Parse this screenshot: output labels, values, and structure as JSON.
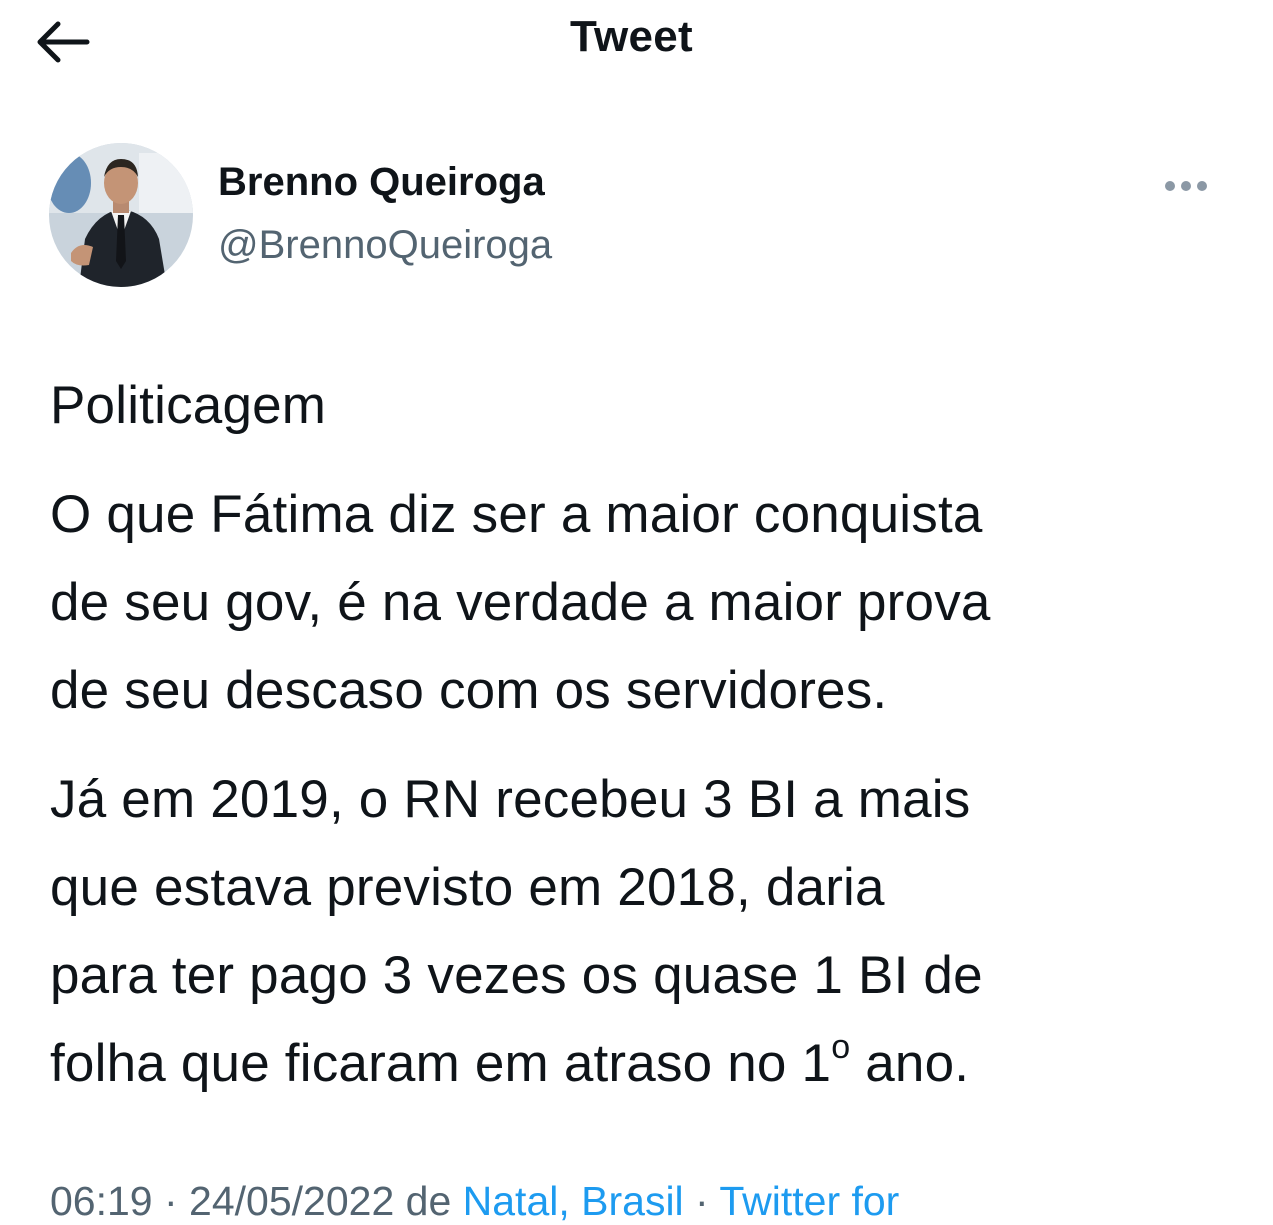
{
  "header": {
    "title": "Tweet",
    "back_icon": "arrow-left-icon"
  },
  "author": {
    "display_name": "Brenno Queiroga",
    "handle": "@BrennoQueiroga",
    "avatar": "avatar-photo",
    "more_icon": "more-horizontal-icon"
  },
  "tweet": {
    "paragraph_1": "Politicagem",
    "paragraph_2_lines": [
      "O que Fátima diz ser a maior conquista",
      "de seu gov, é na verdade a maior prova",
      "de seu descaso com os servidores."
    ],
    "paragraph_3_lines": [
      "Já em 2019, o RN recebeu 3 BI a mais",
      "que estava previsto em 2018, daria",
      "para ter pago 3 vezes os quase 1 BI de"
    ],
    "last_line_before": "folha que ficaram em atraso no 1",
    "last_line_sup": "o",
    "last_line_after": " ano."
  },
  "meta": {
    "time": "06:19",
    "separator_1": " · ",
    "date": "24/05/2022",
    "from_text": " de ",
    "location": "Natal, Brasil",
    "separator_2": " · ",
    "source": "Twitter for"
  },
  "colors": {
    "text": "#0f1419",
    "secondary": "#536471",
    "link": "#1d9bf0"
  }
}
